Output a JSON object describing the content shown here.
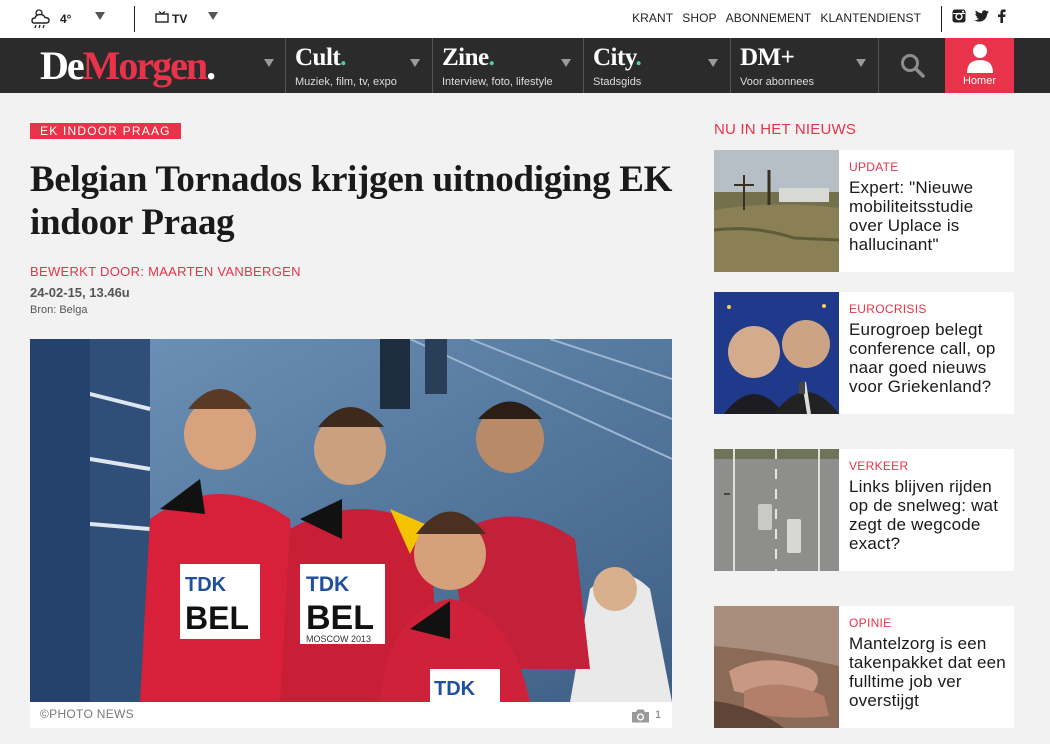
{
  "topbar": {
    "weather_icon": "cloud-rain-icon",
    "temperature": "4°",
    "tv_icon": "tv-icon",
    "tv_label": "TV",
    "links": [
      "KRANT",
      "SHOP",
      "ABONNEMENT",
      "KLANTENDIENST"
    ],
    "social": [
      "instagram-icon",
      "twitter-icon",
      "facebook-icon"
    ]
  },
  "nav": {
    "logo_part1": "De",
    "logo_part2": "Morgen",
    "logo_dot": ".",
    "sections": [
      {
        "title": "Cult",
        "dot": ".",
        "subtitle": "Muziek, film, tv, expo"
      },
      {
        "title": "Zine",
        "dot": ".",
        "subtitle": "Interview, foto, lifestyle"
      },
      {
        "title": "City",
        "dot": ".",
        "subtitle": "Stadsgids"
      },
      {
        "title": "DM+",
        "dot": "",
        "subtitle": "Voor abonnees"
      }
    ],
    "user_label": "Homer"
  },
  "article": {
    "kicker": "EK INDOOR PRAAG",
    "headline": "Belgian Tornados krijgen uitnodiging EK indoor Praag",
    "byline": "BEWERKT DOOR: MAARTEN VANBERGEN",
    "date": "24-02-15, 13.46u",
    "source": "Bron: Belga",
    "photo_credit": "©PHOTO NEWS",
    "photo_count": "1"
  },
  "sidebar": {
    "title": "NU IN HET NIEUWS",
    "items": [
      {
        "category": "UPDATE",
        "title": "Expert: \"Nieuwe mobiliteitsstudie over Uplace is hallucinant\""
      },
      {
        "category": "EUROCRISIS",
        "title": "Eurogroep belegt conference call, op naar goed nieuws voor Griekenland?"
      },
      {
        "category": "VERKEER",
        "title": "Links blijven rijden op de snelweg: wat zegt de wegcode exact?"
      },
      {
        "category": "OPINIE",
        "title": "Mantelzorg is een takenpakket dat een fulltime job ver overstijgt"
      }
    ]
  },
  "colors": {
    "accent": "#e8334a",
    "nav_bg": "#2b2b2b",
    "page_bg": "#f2f2f2",
    "logo_dot_green": "#4fd0a8"
  }
}
